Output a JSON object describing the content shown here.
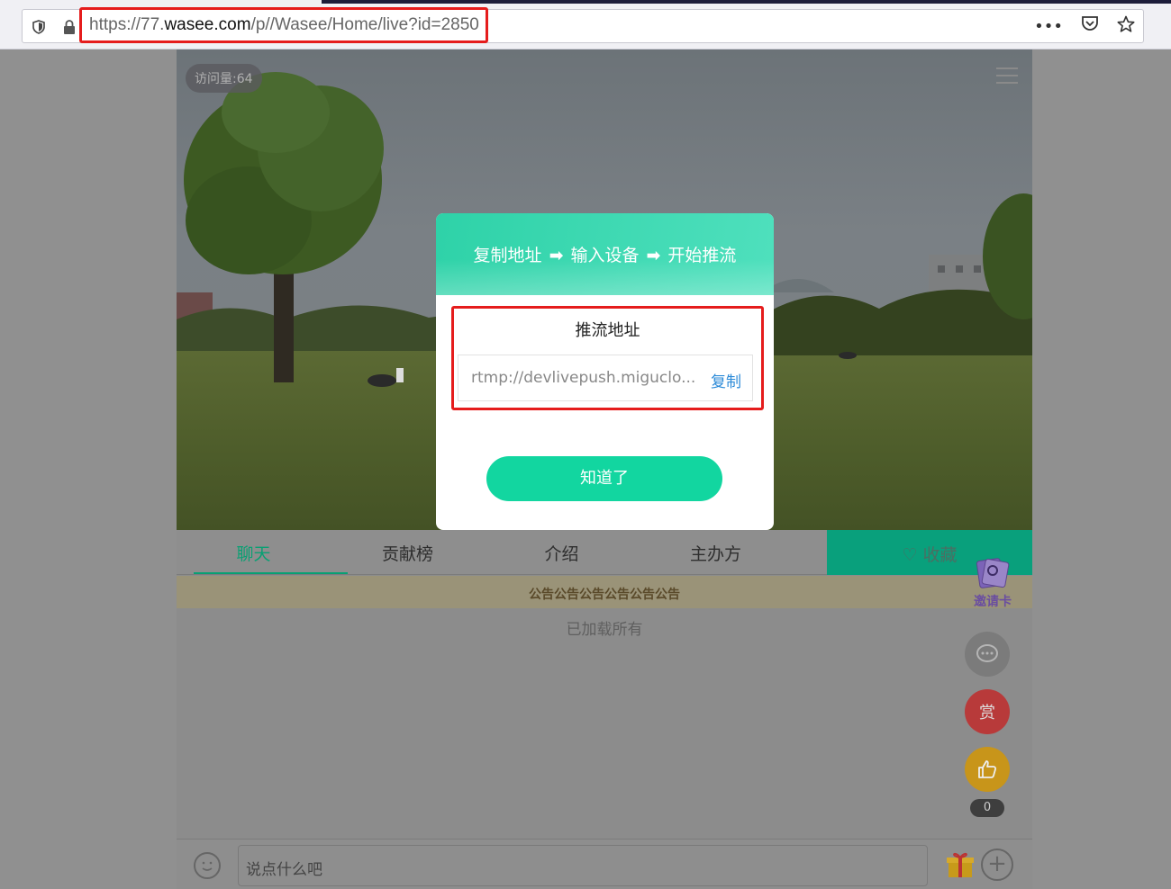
{
  "browser": {
    "url_prefix": "https://77.",
    "url_domain": "wasee.com",
    "url_path": "/p//Wasee/Home/live?id=2850",
    "more_label": "•••"
  },
  "live": {
    "visits": "访问量:64",
    "tabs": [
      "聊天",
      "贡献榜",
      "介绍",
      "主办方"
    ],
    "favorite_label": "收藏",
    "notice": "公告公告公告公告公告公告",
    "loaded_text": "已加载所有",
    "invite_label": "邀请卡",
    "reward_label": "赏",
    "like_count": "0",
    "chat_placeholder": "说点什么吧"
  },
  "modal": {
    "step1": "复制地址",
    "step2": "输入设备",
    "step3": "开始推流",
    "arrow": "➡",
    "push_title": "推流地址",
    "push_url": "rtmp://devlivepush.miguclo...",
    "copy_label": "复制",
    "ok_label": "知道了"
  },
  "colors": {
    "accent": "#12d6a0",
    "highlight": "#e51c1c",
    "link": "#2d8bd8"
  }
}
